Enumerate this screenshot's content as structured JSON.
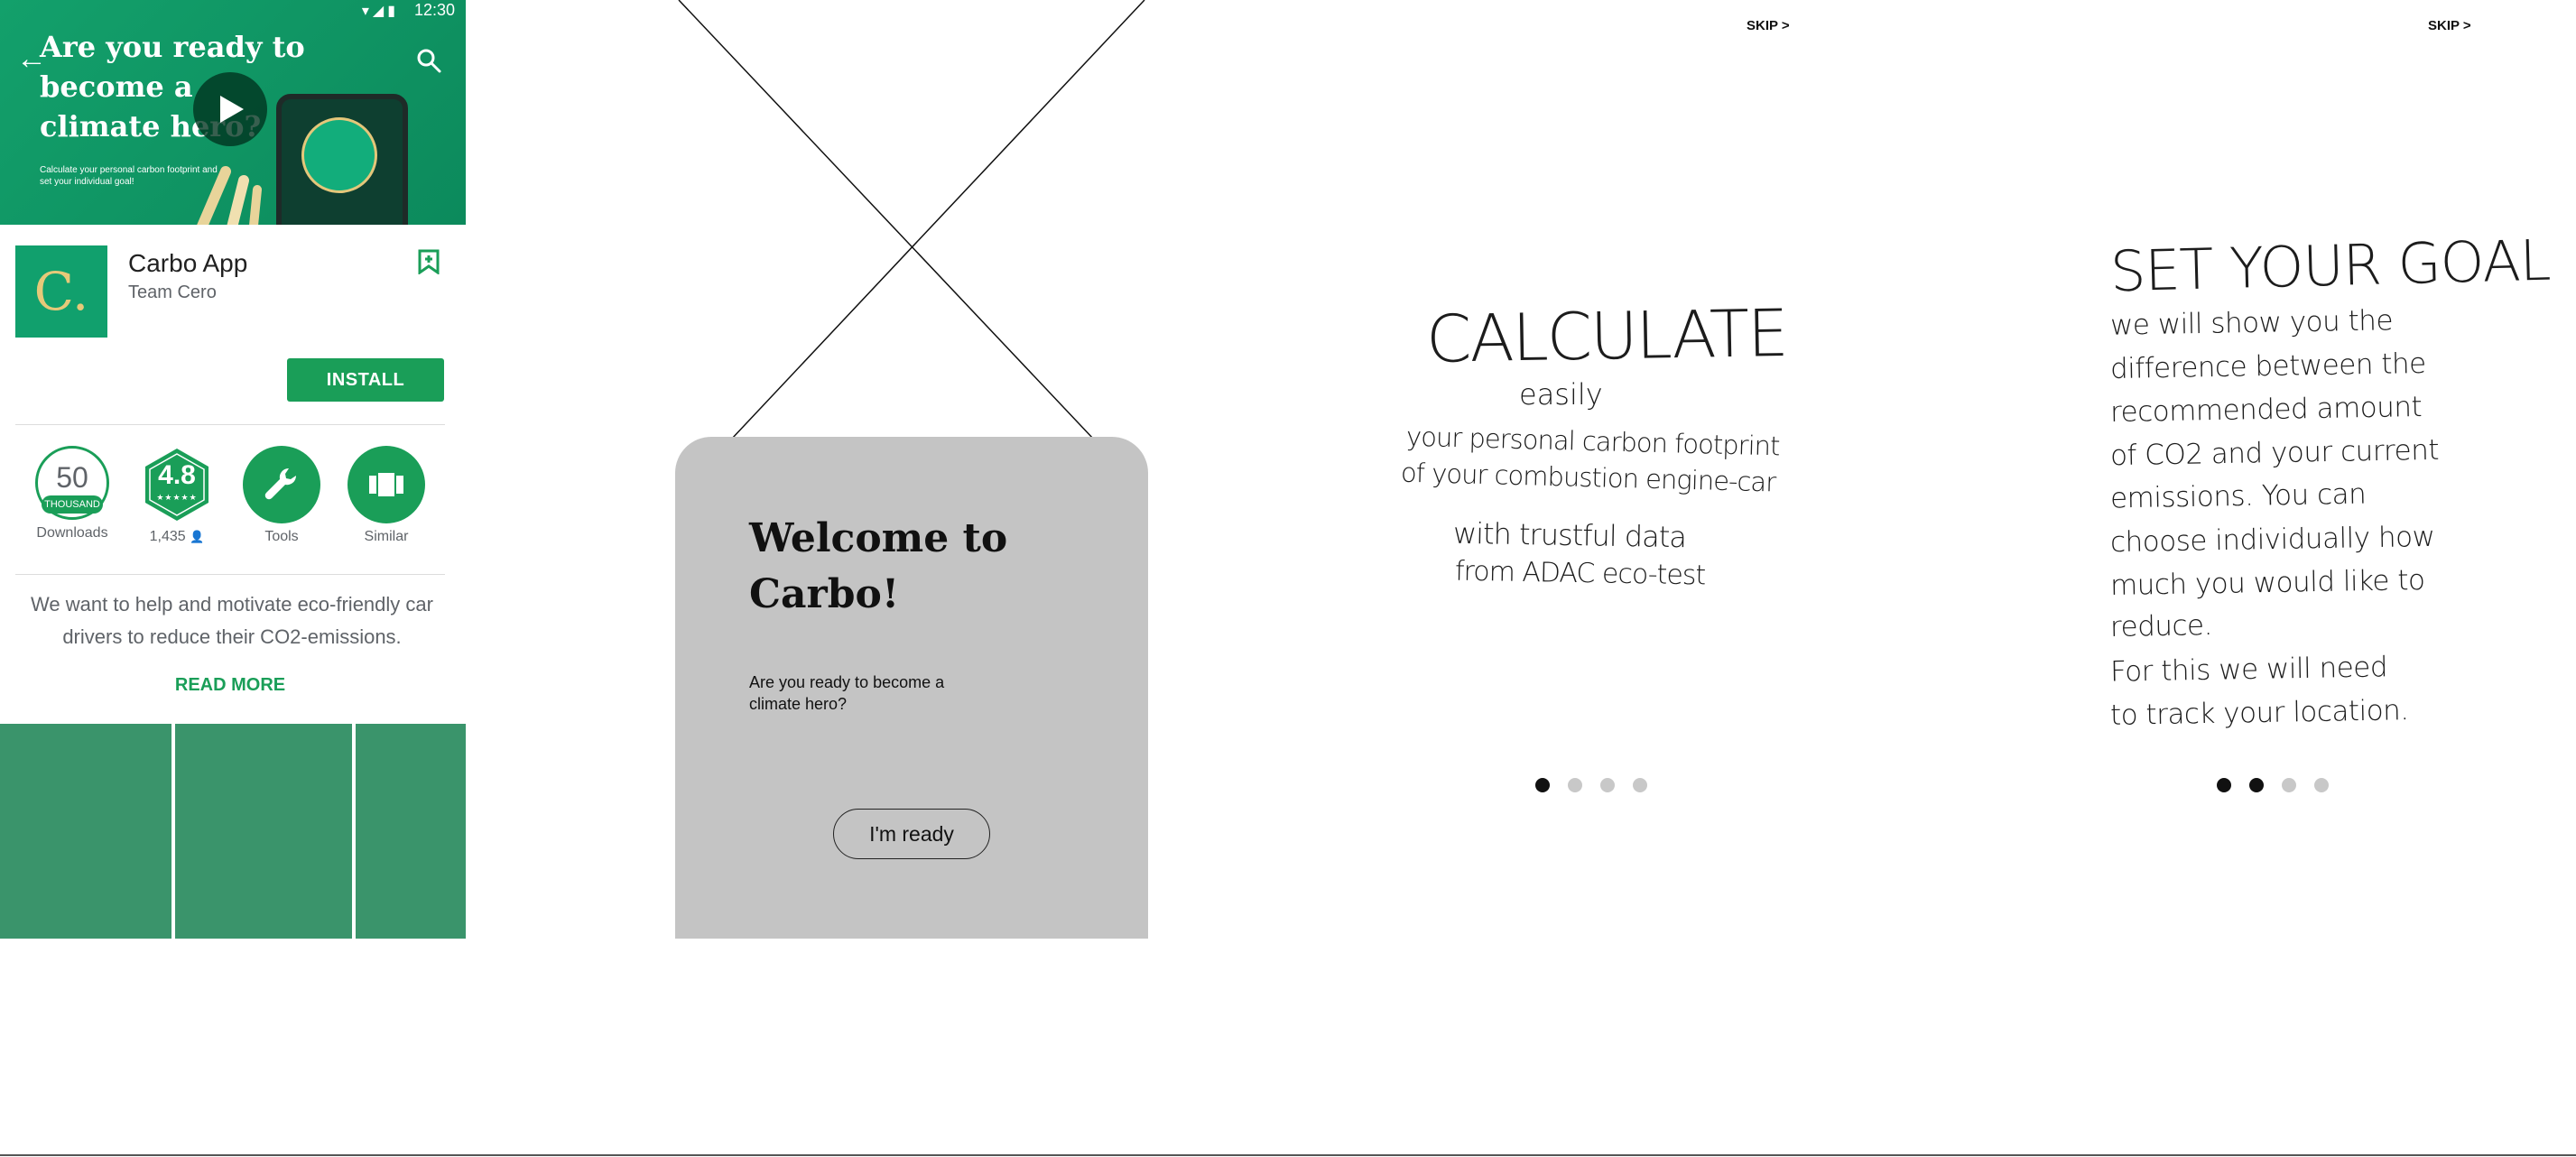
{
  "store": {
    "status": {
      "time": "12:30"
    },
    "hero": {
      "title": "Are you ready to become a climate hero?",
      "subtitle": "Calculate your personal carbon footprint and set your individual goal!"
    },
    "app": {
      "icon_letter": "C.",
      "name": "Carbo App",
      "developer": "Team Cero",
      "install_label": "INSTALL"
    },
    "stats": {
      "downloads_value": "50",
      "downloads_unit": "THOUSAND",
      "downloads_label": "Downloads",
      "rating_value": "4.8",
      "rating_stars": "★★★★★",
      "rating_count": "1,435",
      "tools_label": "Tools",
      "similar_label": "Similar"
    },
    "description": "We want to help and motivate eco-friendly car drivers to reduce their CO2-emissions.",
    "read_more": "READ MORE"
  },
  "welcome": {
    "title": "Welcome to Carbo!",
    "subtitle": "Are you ready to become a climate hero?",
    "button_label": "I'm ready"
  },
  "onboarding": {
    "calculate": {
      "skip_label": "SKIP >",
      "title": "CALCULATE",
      "easily": "easily",
      "line1": "your personal carbon footprint",
      "line2": "of your combustion engine-car",
      "line3": "with trustful data",
      "line4": "from ADAC eco-test",
      "dots_active": 1,
      "dots_total": 4
    },
    "goal": {
      "skip_label": "SKIP >",
      "title": "SET YOUR GOAL",
      "lines": [
        "we will show you the",
        "difference between the",
        "recommended amount",
        "of CO2 and your current",
        "emissions. You can",
        "choose individually how",
        "much you would like to",
        "reduce.",
        "For this we will need",
        "to track your location."
      ],
      "dots_active": 2,
      "dots_total": 4
    }
  },
  "colors": {
    "brand_green": "#1a9e58",
    "hero_green": "#13a06b",
    "screenshot_green": "#3a946b",
    "card_gray": "#c4c4c4"
  }
}
